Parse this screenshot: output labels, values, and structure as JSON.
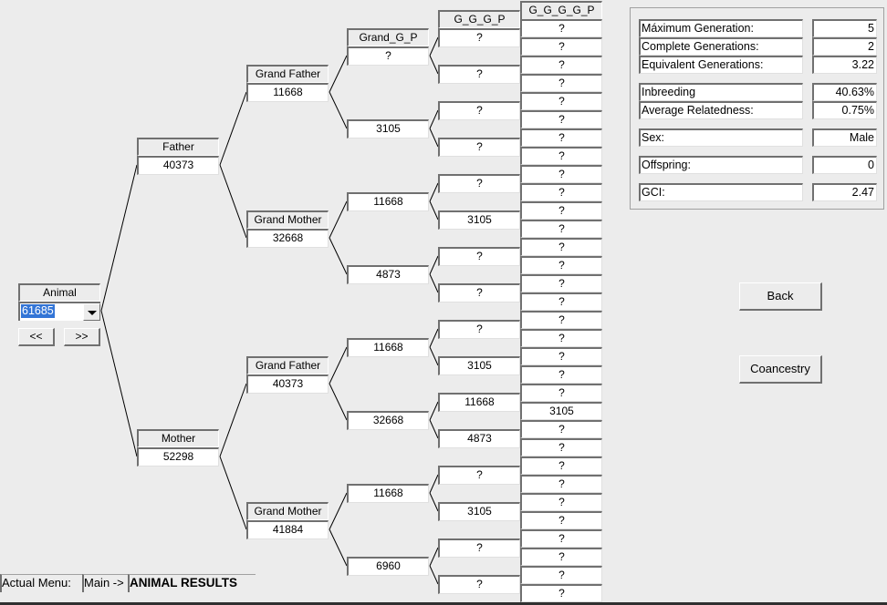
{
  "tree": {
    "animal": {
      "label": "Animal",
      "value": "61685"
    },
    "nav": {
      "prev": "<<",
      "next": ">>"
    },
    "father": {
      "label": "Father",
      "value": "40373"
    },
    "mother": {
      "label": "Mother",
      "value": "52298"
    },
    "grandparents": [
      {
        "label": "Grand Father",
        "value": "11668"
      },
      {
        "label": "Grand Mother",
        "value": "32668"
      },
      {
        "label": "Grand Father",
        "value": "40373"
      },
      {
        "label": "Grand Mother",
        "value": "41884"
      }
    ],
    "ggp_label": "Grand_G_P",
    "ggp": [
      "?",
      "3105",
      "11668",
      "4873",
      "11668",
      "32668",
      "11668",
      "6960"
    ],
    "gggp_label": "G_G_G_P",
    "gggp": [
      "?",
      "?",
      "?",
      "?",
      "?",
      "3105",
      "?",
      "?",
      "?",
      "3105",
      "11668",
      "4873",
      "?",
      "3105",
      "?",
      "?"
    ],
    "ggggp_label": "G_G_G_G_P",
    "ggggp": [
      "?",
      "?",
      "?",
      "?",
      "?",
      "?",
      "?",
      "?",
      "?",
      "?",
      "?",
      "?",
      "?",
      "?",
      "?",
      "?",
      "?",
      "?",
      "?",
      "?",
      "?",
      "3105",
      "?",
      "?",
      "?",
      "?",
      "?",
      "?",
      "?",
      "?",
      "?",
      "?"
    ]
  },
  "stats": [
    {
      "label": "Máximum Generation:",
      "value": "5"
    },
    {
      "label": "Complete Generations:",
      "value": "2"
    },
    {
      "label": "Equivalent Generations:",
      "value": "3.22"
    },
    {
      "label": "Inbreeding",
      "value": "40.63%"
    },
    {
      "label": "Average Relatedness:",
      "value": "0.75%"
    },
    {
      "label": "Sex:",
      "value": "Male"
    },
    {
      "label": "Offspring:",
      "value": "0"
    },
    {
      "label": "GCI:",
      "value": "2.47"
    }
  ],
  "buttons": {
    "back": "Back",
    "coancestry": "Coancestry"
  },
  "status": {
    "label": "Actual Menu:",
    "path": "Main ->",
    "current": "ANIMAL RESULTS"
  },
  "colors": {
    "selection": "#3375d6",
    "background": "#ececec"
  }
}
